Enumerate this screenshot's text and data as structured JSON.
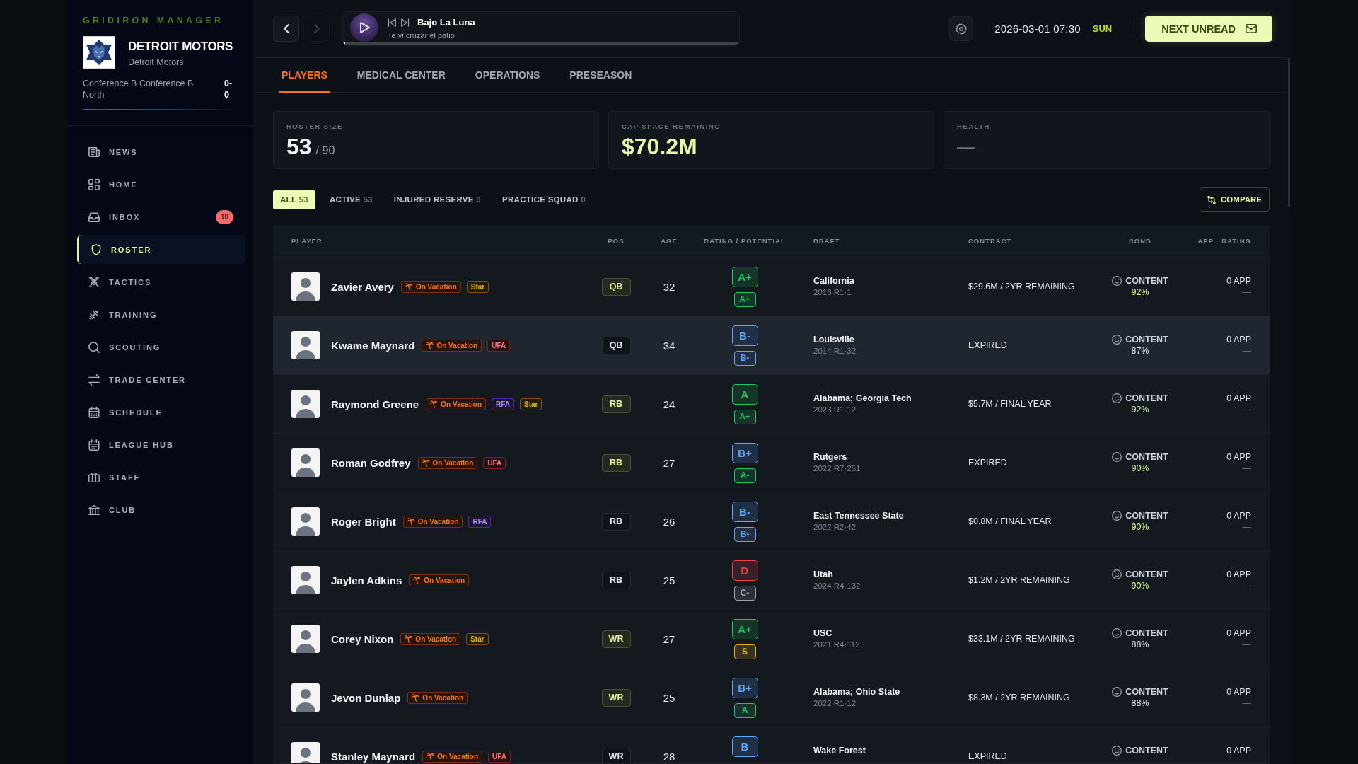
{
  "sidebar": {
    "brand": "GRIDIRON MANAGER",
    "team": {
      "name": "DETROIT MOTORS",
      "subtitle": "Detroit Motors",
      "division": "Conference B Conference B North",
      "record": "0-0"
    },
    "nav": [
      {
        "label": "NEWS",
        "kind": "news",
        "selected": false
      },
      {
        "label": "HOME",
        "kind": "home",
        "selected": false
      },
      {
        "label": "INBOX",
        "kind": "inbox",
        "selected": false,
        "badge": "10"
      },
      {
        "label": "ROSTER",
        "kind": "roster",
        "selected": true
      },
      {
        "label": "TACTICS",
        "kind": "tactics",
        "selected": false
      },
      {
        "label": "TRAINING",
        "kind": "training",
        "selected": false
      },
      {
        "label": "SCOUTING",
        "kind": "scouting",
        "selected": false
      },
      {
        "label": "TRADE CENTER",
        "kind": "trade",
        "selected": false
      },
      {
        "label": "SCHEDULE",
        "kind": "schedule",
        "selected": false
      },
      {
        "label": "LEAGUE HUB",
        "kind": "league",
        "selected": false
      },
      {
        "label": "STAFF",
        "kind": "staff",
        "selected": false
      },
      {
        "label": "CLUB",
        "kind": "club",
        "selected": false
      }
    ]
  },
  "topbar": {
    "nav_buttons": [
      {
        "kind": "back",
        "disabled": false
      },
      {
        "kind": "forward",
        "disabled": true
      }
    ],
    "player": {
      "title": "Bajo La Luna",
      "subtitle": "Te vi cruzar el patio",
      "level": 0.005
    },
    "date": "2026-03-01 07:30",
    "weekday": "SUN",
    "next_button": "NEXT UNREAD"
  },
  "tabs": [
    {
      "label": "PLAYERS",
      "selected": true
    },
    {
      "label": "MEDICAL CENTER",
      "selected": false
    },
    {
      "label": "OPERATIONS",
      "selected": false
    },
    {
      "label": "PRESEASON",
      "selected": false
    }
  ],
  "stats": [
    {
      "label": "ROSTER SIZE",
      "kind": "count",
      "value": "53",
      "total": "/ 90"
    },
    {
      "label": "CAP SPACE REMAINING",
      "kind": "money",
      "value": "$70.2M"
    },
    {
      "label": "HEALTH",
      "kind": "empty",
      "value": "—"
    }
  ],
  "filters": [
    {
      "label": "ALL",
      "count": "53",
      "selected": true
    },
    {
      "label": "ACTIVE",
      "count": "53",
      "selected": false
    },
    {
      "label": "INJURED RESERVE",
      "count": "0",
      "selected": false
    },
    {
      "label": "PRACTICE SQUAD",
      "count": "0",
      "selected": false
    }
  ],
  "compare_button": "COMPARE",
  "table": {
    "columns": [
      "PLAYER",
      "POS",
      "AGE",
      "RATING / POTENTIAL",
      "DRAFT",
      "CONTRACT",
      "COND",
      "APP · RATING"
    ],
    "rows": [
      {
        "name": "Zavier Avery",
        "selected": false,
        "tags": [
          {
            "label": "On Vacation",
            "kind": "vacation"
          },
          {
            "label": "Star",
            "kind": "star"
          }
        ],
        "pos": "QB",
        "starter": true,
        "age": "32",
        "rating": {
          "grade": "A+",
          "color": "#22c55e"
        },
        "potential": {
          "grade": "A+",
          "color": "#22c55e"
        },
        "school": "California",
        "pick": "2016 R1·1",
        "contract": "$29.6M / 2YR REMAINING",
        "condition": "CONTENT",
        "condition_pct": "92%",
        "condition_good": true,
        "apps": "0 APP",
        "app_rating": "—"
      },
      {
        "name": "Kwame Maynard",
        "selected": true,
        "tags": [
          {
            "label": "On Vacation",
            "kind": "vacation"
          },
          {
            "label": "UFA",
            "kind": "ufa"
          }
        ],
        "pos": "QB",
        "starter": false,
        "age": "34",
        "rating": {
          "grade": "B-",
          "color": "#60a5fa"
        },
        "potential": {
          "grade": "B-",
          "color": "#60a5fa"
        },
        "school": "Louisville",
        "pick": "2014 R1·32",
        "contract": "EXPIRED",
        "condition": "CONTENT",
        "condition_pct": "87%",
        "condition_good": false,
        "apps": "0 APP",
        "app_rating": "—"
      },
      {
        "name": "Raymond Greene",
        "selected": false,
        "tags": [
          {
            "label": "On Vacation",
            "kind": "vacation"
          },
          {
            "label": "RFA",
            "kind": "rfa"
          },
          {
            "label": "Star",
            "kind": "star"
          }
        ],
        "pos": "RB",
        "starter": true,
        "age": "24",
        "rating": {
          "grade": "A",
          "color": "#22c55e"
        },
        "potential": {
          "grade": "A+",
          "color": "#22c55e"
        },
        "school": "Alabama; Georgia Tech",
        "pick": "2023 R1·12",
        "contract": "$5.7M / FINAL YEAR",
        "condition": "CONTENT",
        "condition_pct": "92%",
        "condition_good": true,
        "apps": "0 APP",
        "app_rating": "—"
      },
      {
        "name": "Roman Godfrey",
        "selected": false,
        "tags": [
          {
            "label": "On Vacation",
            "kind": "vacation"
          },
          {
            "label": "UFA",
            "kind": "ufa"
          }
        ],
        "pos": "RB",
        "starter": true,
        "age": "27",
        "rating": {
          "grade": "B+",
          "color": "#60a5fa"
        },
        "potential": {
          "grade": "A-",
          "color": "#22c55e"
        },
        "school": "Rutgers",
        "pick": "2022 R7·251",
        "contract": "EXPIRED",
        "condition": "CONTENT",
        "condition_pct": "90%",
        "condition_good": true,
        "apps": "0 APP",
        "app_rating": "—"
      },
      {
        "name": "Roger Bright",
        "selected": false,
        "tags": [
          {
            "label": "On Vacation",
            "kind": "vacation"
          },
          {
            "label": "RFA",
            "kind": "rfa"
          }
        ],
        "pos": "RB",
        "starter": false,
        "age": "26",
        "rating": {
          "grade": "B-",
          "color": "#60a5fa"
        },
        "potential": {
          "grade": "B-",
          "color": "#60a5fa"
        },
        "school": "East Tennessee State",
        "pick": "2022 R2·42",
        "contract": "$0.8M / FINAL YEAR",
        "condition": "CONTENT",
        "condition_pct": "90%",
        "condition_good": true,
        "apps": "0 APP",
        "app_rating": "—"
      },
      {
        "name": "Jaylen Adkins",
        "selected": false,
        "tags": [
          {
            "label": "On Vacation",
            "kind": "vacation"
          }
        ],
        "pos": "RB",
        "starter": false,
        "age": "25",
        "rating": {
          "grade": "D",
          "color": "#ef4444"
        },
        "potential": {
          "grade": "C-",
          "color": "#9ca3af"
        },
        "school": "Utah",
        "pick": "2024 R4·132",
        "contract": "$1.2M / 2YR REMAINING",
        "condition": "CONTENT",
        "condition_pct": "90%",
        "condition_good": true,
        "apps": "0 APP",
        "app_rating": "—"
      },
      {
        "name": "Corey Nixon",
        "selected": false,
        "tags": [
          {
            "label": "On Vacation",
            "kind": "vacation"
          },
          {
            "label": "Star",
            "kind": "star"
          }
        ],
        "pos": "WR",
        "starter": true,
        "age": "27",
        "rating": {
          "grade": "A+",
          "color": "#22c55e"
        },
        "potential": {
          "grade": "S",
          "color": "#eab308"
        },
        "school": "USC",
        "pick": "2021 R4·112",
        "contract": "$33.1M / 2YR REMAINING",
        "condition": "CONTENT",
        "condition_pct": "88%",
        "condition_good": false,
        "apps": "0 APP",
        "app_rating": "—"
      },
      {
        "name": "Jevon Dunlap",
        "selected": false,
        "tags": [
          {
            "label": "On Vacation",
            "kind": "vacation"
          }
        ],
        "pos": "WR",
        "starter": true,
        "age": "25",
        "rating": {
          "grade": "B+",
          "color": "#60a5fa"
        },
        "potential": {
          "grade": "A",
          "color": "#22c55e"
        },
        "school": "Alabama; Ohio State",
        "pick": "2022 R1·12",
        "contract": "$8.3M / 2YR REMAINING",
        "condition": "CONTENT",
        "condition_pct": "88%",
        "condition_good": false,
        "apps": "0 APP",
        "app_rating": "—"
      },
      {
        "name": "Stanley Maynard",
        "selected": false,
        "tags": [
          {
            "label": "On Vacation",
            "kind": "vacation"
          },
          {
            "label": "UFA",
            "kind": "ufa"
          }
        ],
        "pos": "WR",
        "starter": false,
        "age": "28",
        "rating": {
          "grade": "B",
          "color": "#60a5fa"
        },
        "school": "Wake Forest",
        "contract": "EXPIRED",
        "condition": "CONTENT",
        "apps": "0 APP"
      }
    ]
  }
}
